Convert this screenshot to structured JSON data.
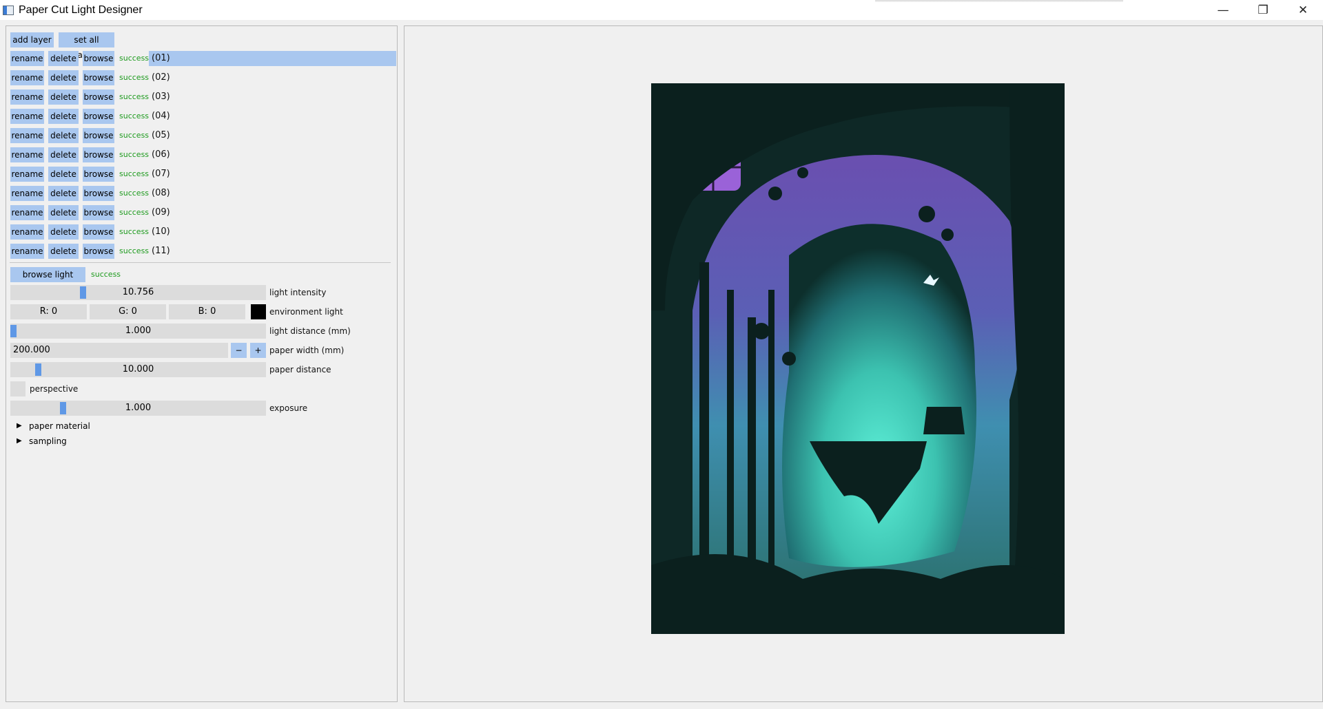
{
  "window": {
    "title": "Paper Cut Light Designer",
    "minimize": "—",
    "maximize": "❐",
    "close": "✕"
  },
  "toolbar": {
    "add_layer": "add layer",
    "set_all_papers": "set all papers"
  },
  "layer_buttons": {
    "rename": "rename",
    "delete": "delete",
    "browse": "browse"
  },
  "layers": [
    {
      "status": "success",
      "name": "(01)",
      "selected": true
    },
    {
      "status": "success",
      "name": "(02)",
      "selected": false
    },
    {
      "status": "success",
      "name": "(03)",
      "selected": false
    },
    {
      "status": "success",
      "name": "(04)",
      "selected": false
    },
    {
      "status": "success",
      "name": "(05)",
      "selected": false
    },
    {
      "status": "success",
      "name": "(06)",
      "selected": false
    },
    {
      "status": "success",
      "name": "(07)",
      "selected": false
    },
    {
      "status": "success",
      "name": "(08)",
      "selected": false
    },
    {
      "status": "success",
      "name": "(09)",
      "selected": false
    },
    {
      "status": "success",
      "name": "(10)",
      "selected": false
    },
    {
      "status": "success",
      "name": "(11)",
      "selected": false
    }
  ],
  "light": {
    "browse_label": "browse light image",
    "status": "success"
  },
  "controls": {
    "light_intensity": {
      "value": "10.756",
      "label": "light intensity",
      "fraction": 0.28
    },
    "environment_light": {
      "r": "R: 0",
      "g": "G: 0",
      "b": "B: 0",
      "label": "environment light",
      "color": "#000000"
    },
    "light_distance": {
      "value": "1.000",
      "label": "light distance (mm)",
      "fraction": 0.0
    },
    "paper_width": {
      "value": "200.000",
      "minus": "−",
      "plus": "+",
      "label": "paper width (mm)"
    },
    "paper_distance": {
      "value": "10.000",
      "label": "paper distance",
      "fraction": 0.1
    },
    "perspective": {
      "label": "perspective",
      "checked": false
    },
    "exposure": {
      "value": "1.000",
      "label": "exposure",
      "fraction": 0.2
    }
  },
  "tree": {
    "paper_material": "paper material",
    "sampling": "sampling"
  },
  "colors": {
    "accent": "#a9c7ef",
    "slider_grab": "#5f98e6",
    "success": "#1d9a1d"
  }
}
